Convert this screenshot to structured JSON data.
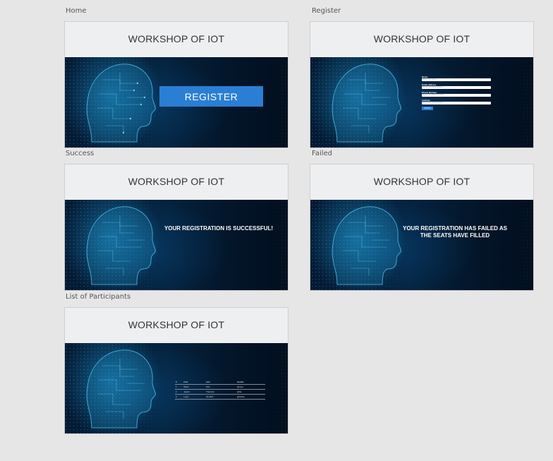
{
  "screens": {
    "home": {
      "label": "Home",
      "title": "WORKSHOP OF IOT",
      "register_button": "REGISTER"
    },
    "register": {
      "label": "Register",
      "title": "WORKSHOP OF IOT",
      "form": {
        "fields": [
          {
            "label": "Name",
            "placeholder": "Enter your Name"
          },
          {
            "label": "Email address",
            "placeholder": "Enter your Email address"
          },
          {
            "label": "Phone Number",
            "placeholder": "Enter your Phone Number"
          },
          {
            "label": "Institute",
            "placeholder": "Enter your Institute Name"
          }
        ],
        "submit": "Submit"
      }
    },
    "success": {
      "label": "Success",
      "title": "WORKSHOP OF IOT",
      "message": "YOUR REGISTRATION IS SUCCESSFUL!"
    },
    "failed": {
      "label": "Failed",
      "title": "WORKSHOP OF IOT",
      "message_line1": "YOUR REGISTRATION HAS FAILED AS",
      "message_line2": "THE SEATS HAVE FILLED"
    },
    "participants": {
      "label": "List of Participants",
      "title": "WORKSHOP OF IOT",
      "table": {
        "headers": [
          "#",
          "First",
          "Last",
          "Handle"
        ],
        "rows": [
          [
            "1",
            "Mark",
            "Otto",
            "@mdo"
          ],
          [
            "2",
            "Jacob",
            "Thornton",
            "@fat"
          ],
          [
            "3",
            "Larry",
            "the Bird",
            "@twitter"
          ]
        ]
      }
    }
  },
  "colors": {
    "canvas_bg": "#e6e6e6",
    "header_bg": "#eeeff0",
    "hero_dark": "#041a33",
    "accent_blue": "#2a7fd4"
  }
}
